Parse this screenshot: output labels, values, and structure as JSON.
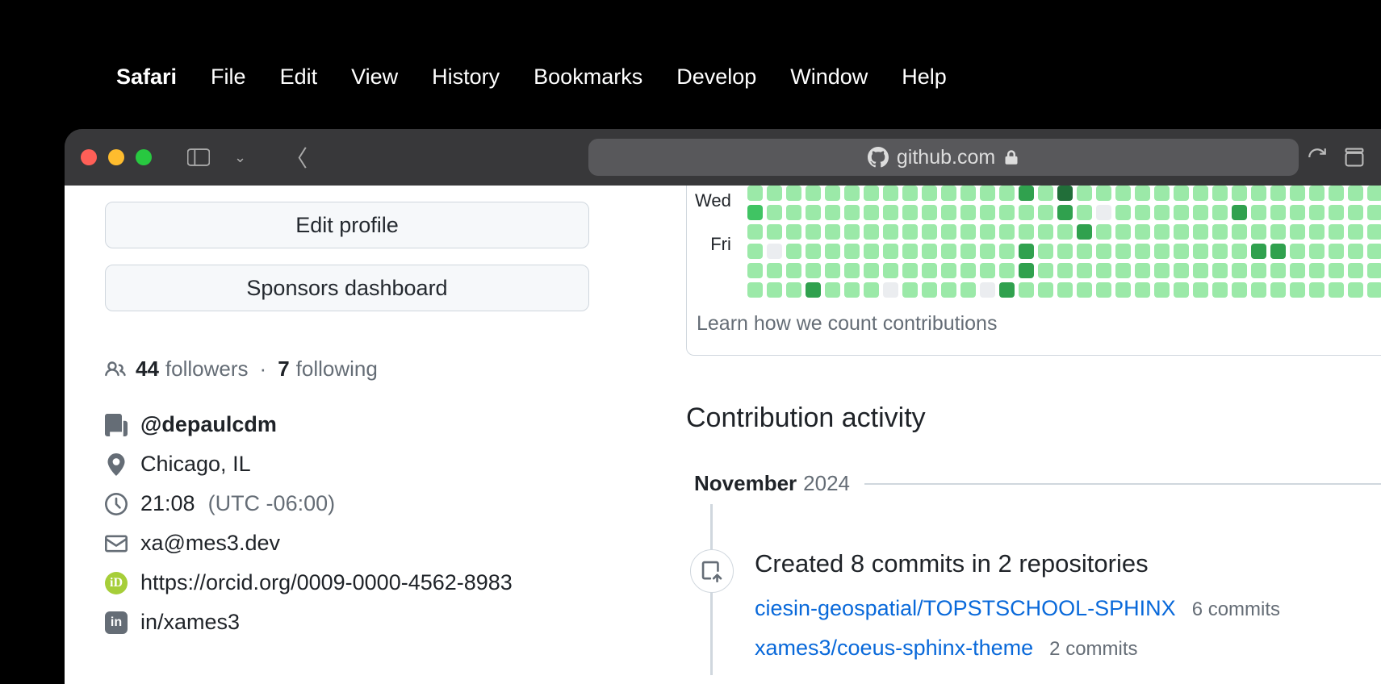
{
  "menubar": {
    "app": "Safari",
    "items": [
      "File",
      "Edit",
      "View",
      "History",
      "Bookmarks",
      "Develop",
      "Window",
      "Help"
    ]
  },
  "toolbar": {
    "url_host": "github.com"
  },
  "profile": {
    "edit_button": "Edit profile",
    "sponsors_button": "Sponsors dashboard",
    "followers_count": "44",
    "followers_label": "followers",
    "following_count": "7",
    "following_label": "following",
    "org": "@depaulcdm",
    "location": "Chicago, IL",
    "time": "21:08",
    "tz": "(UTC -06:00)",
    "email": "xa@mes3.dev",
    "orcid": "https://orcid.org/0009-0000-4562-8983",
    "linkedin": "in/xames3"
  },
  "contrib": {
    "learn_link": "Learn how we count contributions",
    "heading": "Contribution activity",
    "month": "November",
    "year": "2024",
    "day_labels": [
      "Wed",
      "Fri"
    ],
    "activity": {
      "title": "Created 8 commits in 2 repositories",
      "repos": [
        {
          "name": "ciesin-geospatial/TOPSTSCHOOL-SPHINX",
          "commits": "6 commits"
        },
        {
          "name": "xames3/coeus-sphinx-theme",
          "commits": "2 commits"
        }
      ]
    },
    "graph_rows": [
      [
        1,
        1,
        1,
        1,
        1,
        1,
        1,
        1,
        1,
        1,
        1,
        1,
        1,
        1,
        3,
        1,
        4,
        1,
        1,
        1,
        1,
        1,
        1,
        1,
        1,
        1,
        1,
        1,
        1,
        1,
        1,
        1,
        1
      ],
      [
        2,
        1,
        1,
        1,
        1,
        1,
        1,
        1,
        1,
        1,
        1,
        1,
        1,
        1,
        1,
        1,
        3,
        1,
        0,
        1,
        1,
        1,
        1,
        1,
        1,
        3,
        1,
        1,
        1,
        1,
        1,
        1,
        1
      ],
      [
        1,
        1,
        1,
        1,
        1,
        1,
        1,
        1,
        1,
        1,
        1,
        1,
        1,
        1,
        1,
        1,
        1,
        3,
        1,
        1,
        1,
        1,
        1,
        1,
        1,
        1,
        1,
        1,
        1,
        1,
        1,
        1,
        1
      ],
      [
        1,
        0,
        1,
        1,
        1,
        1,
        1,
        1,
        1,
        1,
        1,
        1,
        1,
        1,
        3,
        1,
        1,
        1,
        1,
        1,
        1,
        1,
        1,
        1,
        1,
        1,
        3,
        3,
        1,
        1,
        1,
        1,
        1
      ],
      [
        1,
        1,
        1,
        1,
        1,
        1,
        1,
        1,
        1,
        1,
        1,
        1,
        1,
        1,
        3,
        1,
        1,
        1,
        1,
        1,
        1,
        1,
        1,
        1,
        1,
        1,
        1,
        1,
        1,
        1,
        1,
        1,
        1
      ],
      [
        1,
        1,
        1,
        3,
        1,
        1,
        1,
        0,
        1,
        1,
        1,
        1,
        0,
        3,
        1,
        1,
        1,
        1,
        1,
        1,
        1,
        1,
        1,
        1,
        1,
        1,
        1,
        1,
        1,
        1,
        1,
        1,
        1
      ]
    ]
  }
}
